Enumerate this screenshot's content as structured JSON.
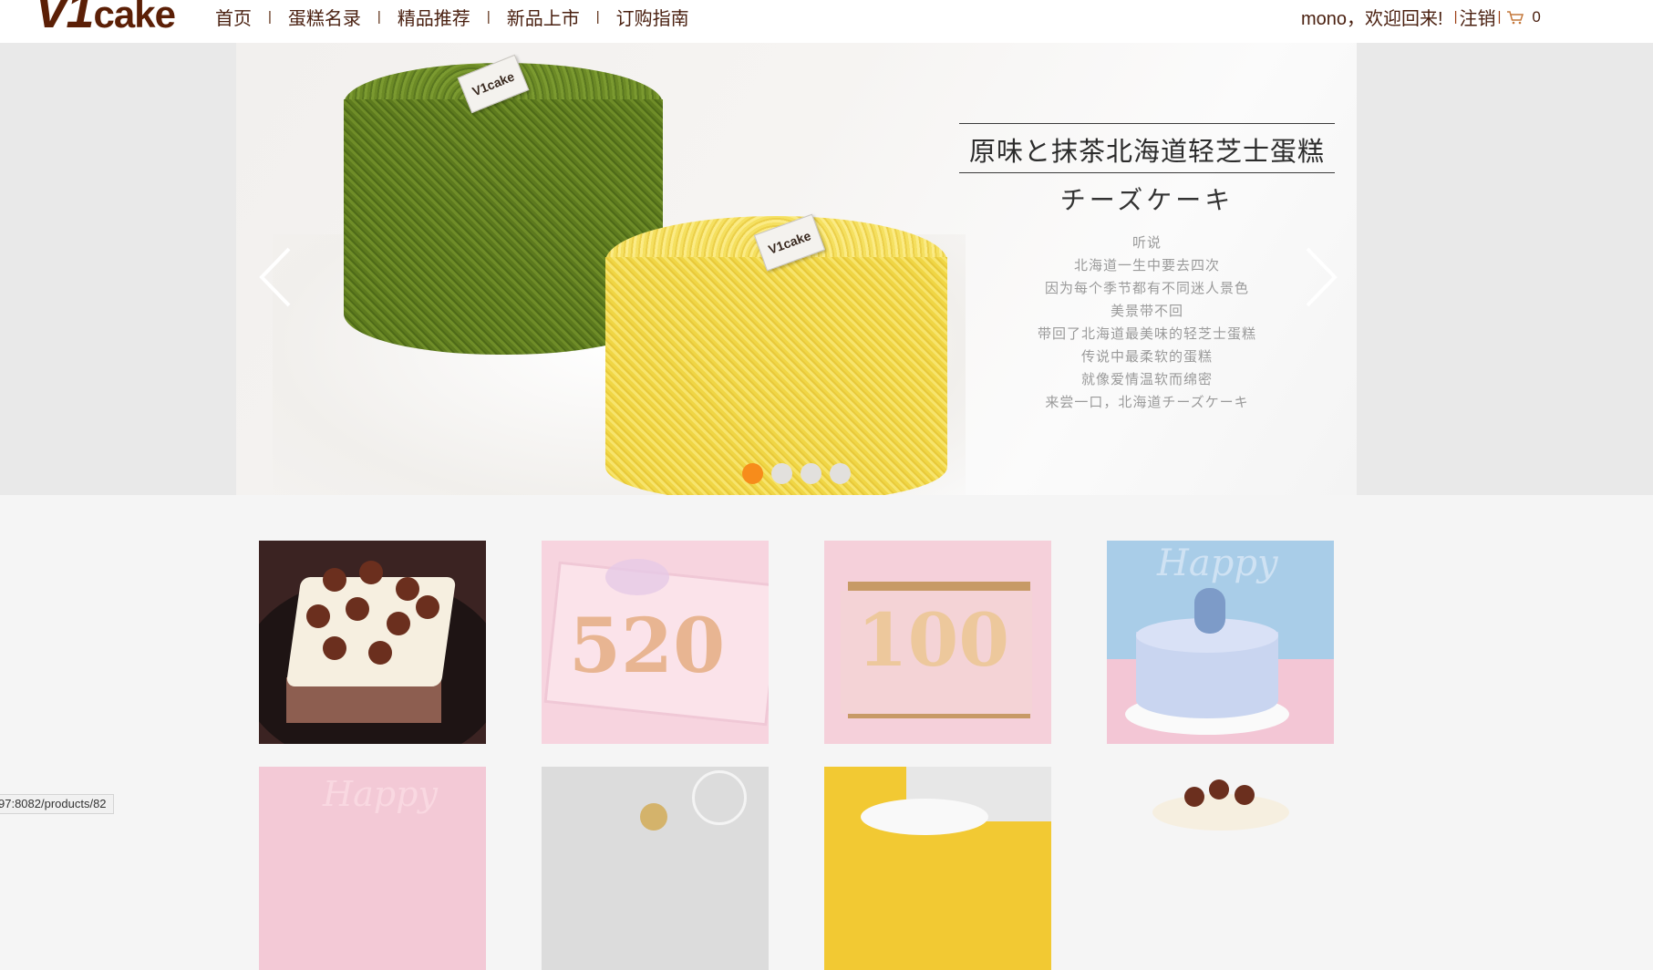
{
  "header": {
    "logo": {
      "mark": "V1",
      "word": "cake"
    },
    "nav": [
      {
        "label": "首页"
      },
      {
        "label": "蛋糕名录"
      },
      {
        "label": "精品推荐"
      },
      {
        "label": "新品上市"
      },
      {
        "label": "订购指南"
      }
    ],
    "nav_separator": "|",
    "user": {
      "welcome": "mono，欢迎回来!",
      "separator": "|",
      "logout": "注销",
      "cart_icon": "cart-icon",
      "cart_count": "0"
    }
  },
  "banner": {
    "title": "原味と抹茶北海道轻芝士蛋糕",
    "subtitle": "チーズケーキ",
    "lines": [
      "听说",
      "北海道一生中要去四次",
      "因为每个季节都有不同迷人景色",
      "美景带不回",
      "带回了北海道最美味的轻芝士蛋糕",
      "传说中最柔软的蛋糕",
      "就像爱情温软而绵密",
      "来尝一口，北海道チーズケーキ"
    ],
    "tag_text": "V1cake",
    "prev_icon": "chevron-left-icon",
    "next_icon": "chevron-right-icon",
    "slide_count": 4,
    "active_slide": 1,
    "active_color": "#f78c1b"
  },
  "products": [
    {
      "image": "chocolate-truffle-square-cake"
    },
    {
      "image": "number-520-cake",
      "number": "520"
    },
    {
      "image": "number-100-cake",
      "number": "100"
    },
    {
      "image": "blue-drip-birthday-cake",
      "text": "Happy"
    },
    {
      "image": "pink-happy-cake",
      "text": "Happy"
    },
    {
      "image": "gray-topper-cake"
    },
    {
      "image": "yellow-marble-cake"
    },
    {
      "image": "chocolate-ball-cake"
    }
  ],
  "status_bar": {
    "url": "97:8082/products/82"
  },
  "colors": {
    "brand": "#5b1f06",
    "nav_text": "#4a2010",
    "page_bg": "#f5f5f5",
    "dot_active": "#f78c1b"
  }
}
